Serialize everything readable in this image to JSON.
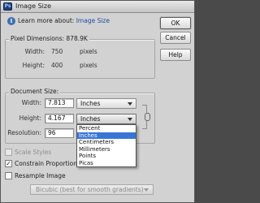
{
  "window": {
    "title": "Image Size",
    "icon": "photoshop-app-icon"
  },
  "info": {
    "prefix": "Learn more about: ",
    "link": "Image Size"
  },
  "buttons": {
    "ok": "OK",
    "cancel": "Cancel",
    "help": "Help"
  },
  "pixel_dimensions": {
    "label": "Pixel Dimensions: 878.9K",
    "width_label": "Width:",
    "width_value": "750",
    "width_unit": "pixels",
    "height_label": "Height:",
    "height_value": "400",
    "height_unit": "pixels"
  },
  "document_size": {
    "label": "Document Size:",
    "width_label": "Width:",
    "width_value": "7.813",
    "width_unit": "Inches",
    "height_label": "Height:",
    "height_value": "4.167",
    "height_unit": "Inches",
    "resolution_label": "Resolution:",
    "resolution_value": "96"
  },
  "unit_dropdown": {
    "options": [
      "Percent",
      "Inches",
      "Centimeters",
      "Millimeters",
      "Points",
      "Picas"
    ],
    "selected": "Inches"
  },
  "options": {
    "scale_styles": "Scale Styles",
    "constrain_proportions": "Constrain Proportions",
    "resample_image": "Resample Image",
    "resample_method": "Bicubic (best for smooth gradients)"
  }
}
